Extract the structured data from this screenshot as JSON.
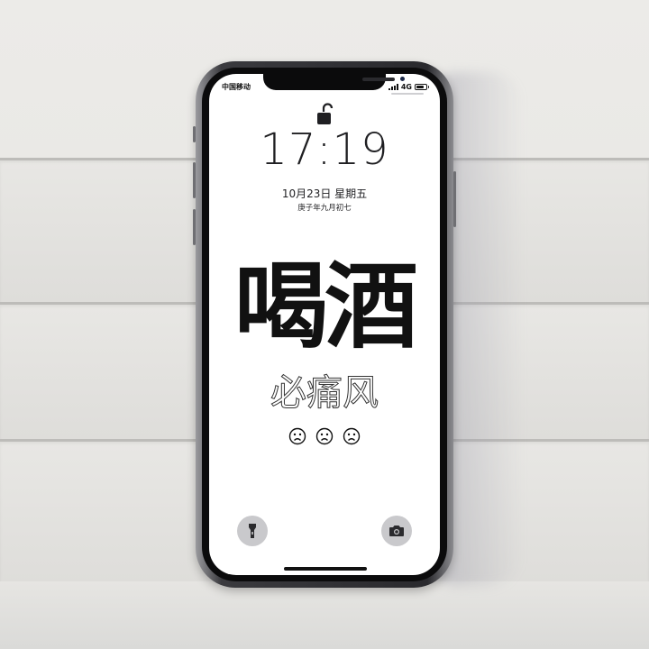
{
  "status_bar": {
    "carrier": "中国移动",
    "network": "4G",
    "signal_bars": 4,
    "battery_level": 0.8
  },
  "lock_screen": {
    "lock_icon": "unlocked-padlock-icon",
    "time": "17:19",
    "date": "10月23日 星期五",
    "lunar_date": "庚子年九月初七"
  },
  "wallpaper": {
    "headline": "喝酒",
    "subline": "必痛风",
    "faces": [
      "sad-face-icon",
      "sad-face-icon",
      "sad-face-icon"
    ]
  },
  "quick_actions": {
    "left_icon": "flashlight-icon",
    "right_icon": "camera-icon"
  },
  "colors": {
    "screen_background": "#ffffff",
    "text": "#1f1f22",
    "quick_action_background": "#c9c9cc"
  }
}
